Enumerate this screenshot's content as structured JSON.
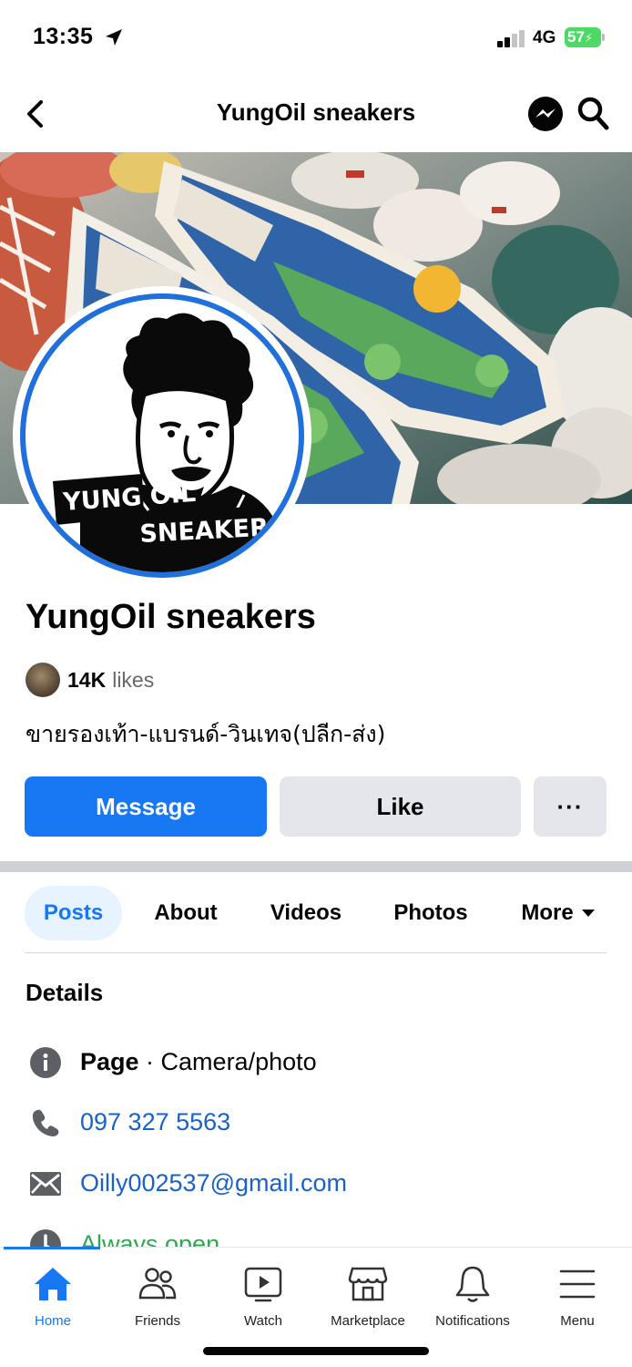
{
  "status_bar": {
    "time": "13:35",
    "network": "4G",
    "battery": "57"
  },
  "header": {
    "title": "YungOil sneakers"
  },
  "profile": {
    "name": "YungOil sneakers",
    "likes_count": "14K",
    "likes_word": "likes",
    "bio": "ขายรองเท้า-แบรนด์-วินเทจ(ปลีก-ส่ง)",
    "logo_line1": "YUNG OIL",
    "logo_line2": "SNEAKERS"
  },
  "actions": {
    "message": "Message",
    "like": "Like",
    "more": "···"
  },
  "tabs": [
    {
      "label": "Posts",
      "active": true
    },
    {
      "label": "About"
    },
    {
      "label": "Videos"
    },
    {
      "label": "Photos"
    },
    {
      "label": "More"
    }
  ],
  "details": {
    "title": "Details",
    "page_label": "Page",
    "page_category": " · Camera/photo",
    "phone": "097 327 5563",
    "email": "Oilly002537@gmail.com",
    "hours": "Always open"
  },
  "bottom_nav": [
    {
      "label": "Home",
      "icon": "home-icon",
      "active": true
    },
    {
      "label": "Friends",
      "icon": "friends-icon"
    },
    {
      "label": "Watch",
      "icon": "watch-icon"
    },
    {
      "label": "Marketplace",
      "icon": "marketplace-icon"
    },
    {
      "label": "Notifications",
      "icon": "bell-icon"
    },
    {
      "label": "Menu",
      "icon": "menu-icon"
    }
  ],
  "colors": {
    "accent": "#1877f2",
    "link": "#1a62c9",
    "open": "#2fa84f",
    "button_gray": "#e4e6eb"
  }
}
